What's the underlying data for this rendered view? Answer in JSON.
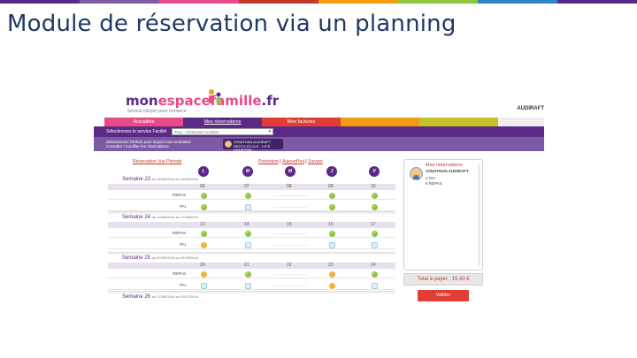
{
  "slide": {
    "title": "Module de réservation via un planning",
    "accent_colors": [
      "#5b2a86",
      "#7c5aa4",
      "#e84a8a",
      "#c0392b",
      "#f39c12",
      "#8cc63f",
      "#2e86c1",
      "#5b2a86"
    ]
  },
  "app": {
    "logo_part1": "mon",
    "logo_part2": "espacefamille",
    "logo_part3": ".fr",
    "tagline": "Service citoyen pour l'enfance",
    "user_name": "AUDIRAFT"
  },
  "menu": {
    "tabs": [
      {
        "label": "Actualités",
        "color": "#e84a8a"
      },
      {
        "label": "Mes réservations",
        "color": "#5b2a86"
      },
      {
        "label": "Mes factures",
        "color": "#e03e35"
      },
      {
        "label": "",
        "color": "#f39c12"
      },
      {
        "label": "",
        "color": "#c4c224"
      }
    ]
  },
  "service": {
    "label": "Sélectionnez le service Facilité",
    "selected": "Taux - restaurant scolaire"
  },
  "child_select": {
    "label": "Sélectionnez l'enfant pour lequel vous souhaitez consulter / modifier les réservations",
    "child_name": "JONATHAN AUDIRAFT",
    "child_school": "RESTO ÉCOLE - CP É. COURTINE"
  },
  "view_link": "Réservation Vue Période",
  "nav": {
    "prev": "Précédent",
    "today": "Aujourd'hui",
    "next": "Suivant",
    "sep": " | "
  },
  "days": [
    "L",
    "M",
    "M",
    "J",
    "V"
  ],
  "status_legend": {
    "ok": "check-icon",
    "pending": "orange-dot-icon",
    "empty": "empty-box-icon"
  },
  "weeks": [
    {
      "title": "Semaine 23",
      "range": "du 06/06/2016 au 10/06/2016",
      "dates": [
        "06",
        "07",
        "08",
        "09",
        "10"
      ],
      "rows": [
        {
          "label": "REPAS",
          "cells": [
            "ok",
            "ok",
            "none",
            "ok",
            "ok"
          ]
        },
        {
          "label": "PAI",
          "cells": [
            "ok",
            "empty",
            "none",
            "ok",
            "ok"
          ]
        }
      ]
    },
    {
      "title": "Semaine 24",
      "range": "du 13/06/2016 au 17/06/2016",
      "dates": [
        "13",
        "14",
        "15",
        "16",
        "17"
      ],
      "rows": [
        {
          "label": "REPAS",
          "cells": [
            "ok",
            "ok",
            "none",
            "ok",
            "ok"
          ]
        },
        {
          "label": "PAI",
          "cells": [
            "pend",
            "empty",
            "none",
            "empty",
            "empty"
          ]
        }
      ]
    },
    {
      "title": "Semaine 25",
      "range": "du 20/06/2016 au 24/06/2016",
      "dates": [
        "20",
        "21",
        "22",
        "23",
        "24"
      ],
      "rows": [
        {
          "label": "REPAS",
          "cells": [
            "pend",
            "ok",
            "none",
            "pend",
            "ok"
          ]
        },
        {
          "label": "PAI",
          "cells": [
            "empty",
            "empty",
            "none",
            "pend",
            "empty"
          ]
        }
      ]
    },
    {
      "title": "Semaine 26",
      "range": "du 27/06/2016 au 01/07/2016",
      "dates": [],
      "rows": []
    }
  ],
  "reservations_panel": {
    "title": "Mes réservations",
    "child_name": "JONATHAN AUDIRAFT",
    "lines": [
      "4 PAI",
      "6 REPAS"
    ]
  },
  "total": "Total à payer : 15,43 €",
  "validate": "Valider"
}
